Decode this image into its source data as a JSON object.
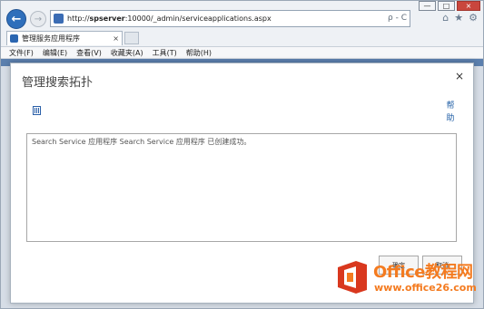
{
  "browser": {
    "url_prefix": "http://",
    "url_host": "spserver",
    "url_rest": ":10000/_admin/serviceapplications.aspx",
    "addr_tools": "ρ - C",
    "tab_title": "管理服务应用程序",
    "tab_close": "×",
    "nav_back": "←",
    "nav_forward": "→",
    "fav_icons": [
      "⌂",
      "★",
      "⚙"
    ],
    "win_controls": [
      "—",
      "□",
      "×"
    ]
  },
  "menubar": [
    "文件(F)",
    "编辑(E)",
    "查看(V)",
    "收藏夹(A)",
    "工具(T)",
    "帮助(H)"
  ],
  "dialog": {
    "title": "管理搜索拓扑",
    "close": "×",
    "help_label": "帮助",
    "message": "Search Service 应用程序 Search Service 应用程序 已创建成功。",
    "ok_label": "确定",
    "cancel_label": "取消"
  },
  "watermark": {
    "title": "Office教程网",
    "url": "www.office26.com",
    "colors": {
      "orange": "#f47b20",
      "red": "#d9381e"
    }
  },
  "colors": {
    "accent": "#2f6fbb",
    "link": "#1f5ea5"
  }
}
